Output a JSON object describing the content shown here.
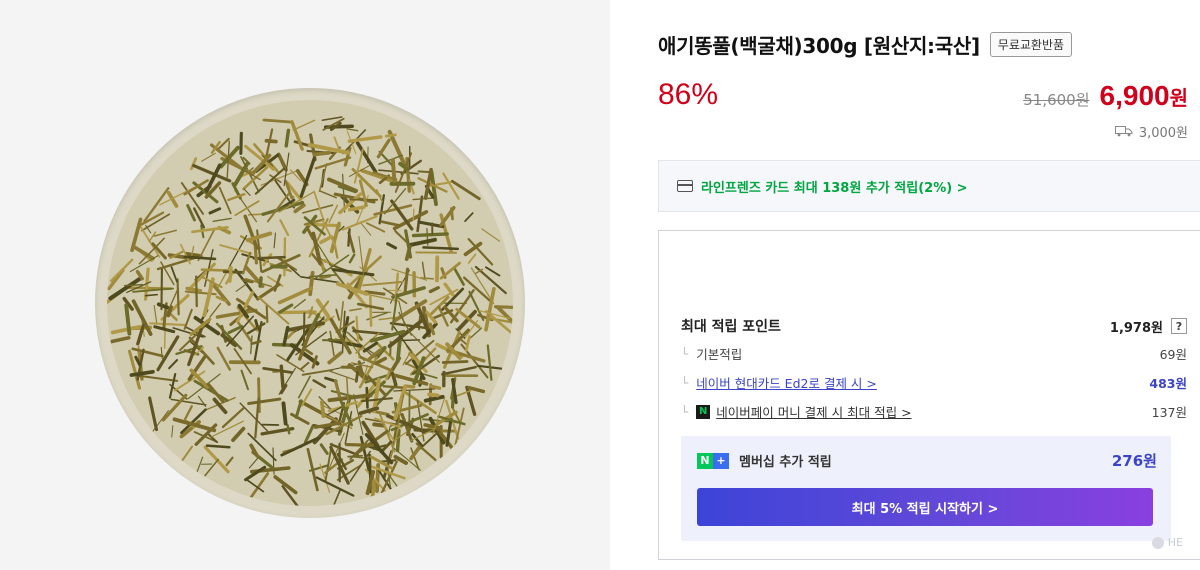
{
  "product": {
    "title": "애기똥풀(백굴채)300g [원산지:국산]",
    "badge": "무료교환반품",
    "discount": "86%",
    "original_price": "51,600원",
    "sale_price": "6,900",
    "sale_unit": "원",
    "shipping_fee": "3,000원"
  },
  "card_benefit": {
    "text": "라인프렌즈 카드 최대 138원 추가 적립(2%) >"
  },
  "points": {
    "title": "최대 적립 포인트",
    "total": "1,978원",
    "help_label": "?",
    "rows": [
      {
        "label": "기본적립",
        "value": "69원"
      },
      {
        "label": "네이버 현대카드 Ed2로 결제 시 >",
        "value": "483원"
      },
      {
        "label": "네이버페이 머니 결제 시 최대 적립 >",
        "value": "137원"
      }
    ]
  },
  "membership": {
    "label": "멤버십 추가 적립",
    "value": "276원",
    "button": "최대 5% 적립 시작하기 >",
    "npay_glyph": "N",
    "plus_glyphs": [
      "N",
      "+"
    ]
  },
  "watermark": {
    "text": "HE"
  },
  "icons": [
    "herb-plate-image",
    "truck-icon",
    "card-icon",
    "help-icon",
    "npay-icon",
    "nplus-icon"
  ],
  "colors": {
    "accent_red": "#d0021b",
    "green": "#00a640",
    "blue": "#3b43c8"
  }
}
